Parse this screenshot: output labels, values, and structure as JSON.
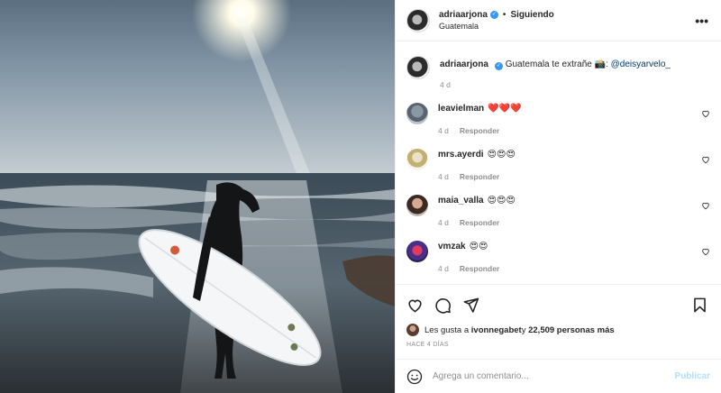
{
  "post": {
    "author": "adriaarjona",
    "follow_separator": "•",
    "follow_status": "Siguiendo",
    "location": "Guatemala",
    "more_icon": "more-horizontal-icon",
    "caption": {
      "username": "adriaarjona",
      "text": "Guatemala te extrañe 📸: ",
      "mention": "@deisyarvelo_",
      "time": "4 d"
    }
  },
  "comments": [
    {
      "username": "leavielman",
      "text": "❤️❤️❤️",
      "time": "4 d",
      "reply": "Responder"
    },
    {
      "username": "mrs.ayerdi",
      "text": "😍😍😍",
      "time": "4 d",
      "reply": "Responder"
    },
    {
      "username": "maia_valla",
      "text": "😍😍😍",
      "time": "4 d",
      "reply": "Responder"
    },
    {
      "username": "vmzak",
      "text": "😍😍",
      "time": "4 d",
      "reply": "Responder"
    }
  ],
  "likes": {
    "prefix": "Les gusta a ",
    "user": "ivonnegabet",
    "middle": " y ",
    "count": "22,509 personas más"
  },
  "posted": "HACE 4 DÍAS",
  "add_comment": {
    "placeholder": "Agrega un comentario...",
    "publish": "Publicar"
  },
  "colors": {
    "accent": "#3897f0",
    "publish_disabled": "#b2dffc",
    "heart": "#ed4956"
  }
}
